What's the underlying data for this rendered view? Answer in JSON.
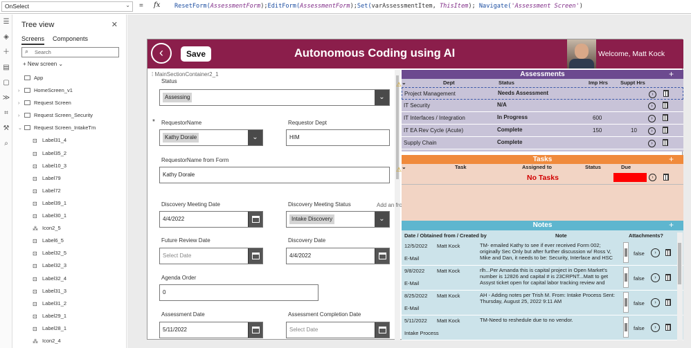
{
  "topbar": {
    "property": "OnSelect",
    "equals": "=",
    "fx": "fx",
    "formula": [
      {
        "t": "ResetForm(",
        "c": "fn"
      },
      {
        "t": "AssessmentForm",
        "c": "id"
      },
      {
        "t": ");",
        "c": ""
      },
      {
        "t": "EditForm(",
        "c": "fn"
      },
      {
        "t": "AssessmentForm",
        "c": "id"
      },
      {
        "t": ");",
        "c": ""
      },
      {
        "t": "Set(",
        "c": "fn"
      },
      {
        "t": "varAssessmentItem, ",
        "c": ""
      },
      {
        "t": "ThisItem",
        "c": "id"
      },
      {
        "t": "); ",
        "c": ""
      },
      {
        "t": "Navigate(",
        "c": "fn"
      },
      {
        "t": "'Assessment Screen'",
        "c": "st"
      },
      {
        "t": ")",
        "c": ""
      }
    ]
  },
  "tree": {
    "title": "Tree view",
    "tabs": [
      "Screens",
      "Components"
    ],
    "search_placeholder": "Search",
    "new_screen": "New screen",
    "items": [
      {
        "label": "App",
        "kind": "app",
        "indent": 0
      },
      {
        "label": "HomeScreen_v1",
        "kind": "screen",
        "indent": 0,
        "caret": "›"
      },
      {
        "label": "Request Screen",
        "kind": "screen",
        "indent": 0,
        "caret": "›"
      },
      {
        "label": "Request Screen_Security",
        "kind": "screen",
        "indent": 0,
        "caret": "›"
      },
      {
        "label": "Request Screen_IntakeTm",
        "kind": "screen",
        "indent": 0,
        "caret": "⌄"
      },
      {
        "label": "Label31_4",
        "kind": "label",
        "indent": 1
      },
      {
        "label": "Label35_2",
        "kind": "label",
        "indent": 1
      },
      {
        "label": "Label10_3",
        "kind": "label",
        "indent": 1
      },
      {
        "label": "Label79",
        "kind": "label",
        "indent": 1
      },
      {
        "label": "Label72",
        "kind": "label",
        "indent": 1
      },
      {
        "label": "Label39_1",
        "kind": "label",
        "indent": 1
      },
      {
        "label": "Label30_1",
        "kind": "label",
        "indent": 1
      },
      {
        "label": "Icon2_5",
        "kind": "icon",
        "indent": 1
      },
      {
        "label": "Label6_5",
        "kind": "label",
        "indent": 1
      },
      {
        "label": "Label32_5",
        "kind": "label",
        "indent": 1
      },
      {
        "label": "Label32_3",
        "kind": "label",
        "indent": 1
      },
      {
        "label": "Label32_4",
        "kind": "label",
        "indent": 1
      },
      {
        "label": "Label31_3",
        "kind": "label",
        "indent": 1
      },
      {
        "label": "Label31_2",
        "kind": "label",
        "indent": 1
      },
      {
        "label": "Label29_1",
        "kind": "label",
        "indent": 1
      },
      {
        "label": "Label28_1",
        "kind": "label",
        "indent": 1
      },
      {
        "label": "Icon2_4",
        "kind": "icon",
        "indent": 1
      }
    ]
  },
  "app": {
    "back": "‹",
    "save": "Save",
    "title": "Autonomous Coding using AI",
    "welcome": "Welcome, Matt Kock"
  },
  "form": {
    "container": "MainSectionContainer2_1",
    "status": {
      "label": "Status",
      "value": "Assessing"
    },
    "requestor": {
      "label": "RequestorName",
      "value": "Kathy Dorale"
    },
    "dept": {
      "label": "Requestor Dept",
      "value": "HIM"
    },
    "fromform": {
      "label": "RequestorName from Form",
      "value": "Kathy Dorale"
    },
    "dmd": {
      "label": "Discovery Meeting Date",
      "value": "4/4/2022"
    },
    "dms": {
      "label": "Discovery Meeting Status",
      "value": "Intake Discovery"
    },
    "frd": {
      "label": "Future Review Date",
      "placeholder": "Select Date"
    },
    "dd": {
      "label": "Discovery Date",
      "value": "4/4/2022"
    },
    "agenda": {
      "label": "Agenda Order",
      "value": "0"
    },
    "ad": {
      "label": "Assessment Date",
      "value": "5/11/2022"
    },
    "acd": {
      "label": "Assessment Completion Date",
      "placeholder": "Select Date"
    },
    "hint": "Add an     from the Insert pane"
  },
  "assessments": {
    "title": "Assessments",
    "plus": "+",
    "cols": [
      "Dept",
      "Status",
      "Imp Hrs",
      "Suppt Hrs"
    ],
    "rows": [
      {
        "dept": "Project Management",
        "status": "Needs Assessment",
        "imp": "",
        "suppt": ""
      },
      {
        "dept": "IT Security",
        "status": "N/A",
        "imp": "",
        "suppt": ""
      },
      {
        "dept": "IT Interfaces / Integration",
        "status": "In Progress",
        "imp": "600",
        "suppt": ""
      },
      {
        "dept": "IT EA Rev Cycle (Acute)",
        "status": "Complete",
        "imp": "150",
        "suppt": "10"
      },
      {
        "dept": "Supply Chain",
        "status": "Complete",
        "imp": "",
        "suppt": ""
      }
    ]
  },
  "tasks": {
    "title": "Tasks",
    "plus": "+",
    "cols": [
      "Task",
      "Assigned to",
      "Status",
      "Due"
    ],
    "empty": "No Tasks"
  },
  "notes": {
    "title": "Notes",
    "plus": "+",
    "cols": [
      "Date / Obtained from / Created by",
      "Note",
      "Attachments?"
    ],
    "rows": [
      {
        "date": "12/5/2022",
        "by": "Matt Kock",
        "src": "E-Mail",
        "note": "TM- emailed Kathy to see if ever received Form 002; originally Sec Only but after further discussion w/ Ross V, Mike and Dan, it needs to be:  Security, Interface and HSC",
        "att": "false"
      },
      {
        "date": "9/8/2022",
        "by": "Matt Kock",
        "src": "E-Mail",
        "note": "rlh...Per Amanda this is capital project in Open Market's number is 12826 and capital # is  23CRPNT...Matt to get Assyst ticket open for capital labor tracking review and",
        "att": "false"
      },
      {
        "date": "8/25/2022",
        "by": "Matt Kock",
        "src": "E-Mail",
        "note": "AH - Adding notes per Trish M.\n\nFrom: Intake Process\nSent: Thursday, August 25, 2022 9:11 AM",
        "att": "false"
      },
      {
        "date": "5/11/2022",
        "by": "Matt Kock",
        "src": "Intake Process",
        "note": "TM-Need to reshedule due to no vendor.",
        "att": "false"
      }
    ]
  }
}
